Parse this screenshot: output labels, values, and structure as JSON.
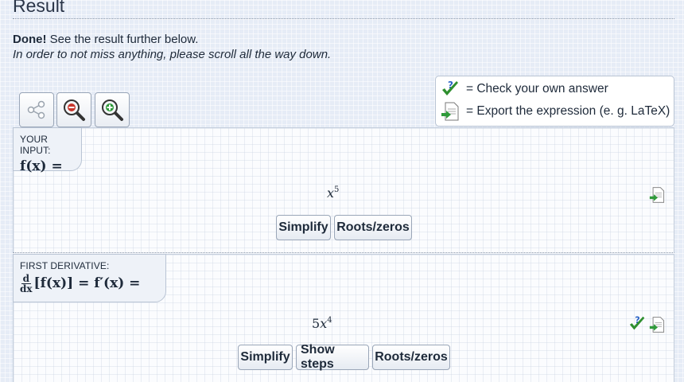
{
  "page": {
    "heading": "Result",
    "done_bold": "Done!",
    "done_text": " See the result further below.",
    "note": "In order to not miss anything, please scroll all the way down."
  },
  "toolbar": {
    "icons": [
      "share-icon",
      "zoom-out-icon",
      "zoom-in-icon"
    ]
  },
  "legend": {
    "check_text": "= Check your own answer",
    "export_text": "= Export the expression (e. g. LaTeX)",
    "check_icon": "check-answer-icon",
    "export_icon": "export-icon"
  },
  "input_panel": {
    "label": "YOUR INPUT:",
    "lhs": "f(x) =",
    "expression_base": "x",
    "expression_exp": "5",
    "buttons": [
      "Simplify",
      "Roots/zeros"
    ]
  },
  "derivative_panel": {
    "label": "FIRST DERIVATIVE:",
    "frac_num": "d",
    "frac_den": "dx",
    "lhs": "[f(x)] = f′(x) =",
    "expression_coef": "5",
    "expression_base": "x",
    "expression_exp": "4",
    "buttons": [
      "Simplify",
      "Show steps",
      "Roots/zeros"
    ]
  },
  "colors": {
    "accent_green": "#2f8f2f",
    "accent_blue": "#2b63c6",
    "zoom_out_red": "#c8362c",
    "zoom_in_green": "#2f9a3a"
  }
}
